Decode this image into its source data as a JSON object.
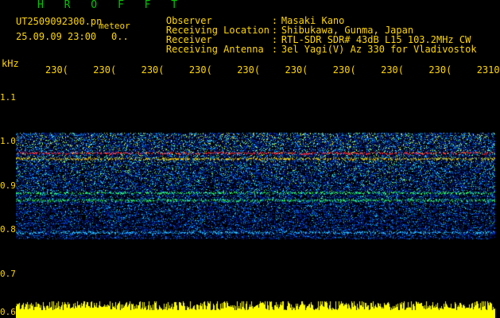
{
  "header": {
    "brand": "H R O F F T",
    "filename": "UT2509092300.pn",
    "meteor_tag": "meteor",
    "datetime": "25.09.09 23:00",
    "status": "0.."
  },
  "info": [
    {
      "label": "Observer",
      "value": "Masaki Kano"
    },
    {
      "label": "Receiving Location",
      "value": "Shibukawa, Gunma, Japan"
    },
    {
      "label": "Receiver",
      "value": "RTL-SDR SDR# 43dB L15 103.2MHz CW"
    },
    {
      "label": "Receiving Antenna",
      "value": "3el Yagi(V) Az 330 for Vladivostok"
    }
  ],
  "chart_data": {
    "type": "heatmap",
    "ylabel": "kHz",
    "x_tick_labels": [
      "230(",
      "230(",
      "230(",
      "230(",
      "230(",
      "230(",
      "230(",
      "230(",
      "230(",
      "2310"
    ],
    "y_tick_labels": [
      "1.1",
      "1.0",
      "0.9",
      "0.8",
      "0.7",
      "0.6"
    ],
    "ylim": [
      0.6,
      1.15
    ],
    "noise_band_khz": [
      0.78,
      1.02
    ],
    "signal_lines_khz": [
      {
        "freq": 0.975,
        "color": "#ff3030"
      },
      {
        "freq": 0.962,
        "color": "#ffd000"
      },
      {
        "freq": 0.885,
        "color": "#30ff60"
      },
      {
        "freq": 0.868,
        "color": "#30ff60"
      },
      {
        "freq": 0.795,
        "color": "#30c0ff"
      }
    ],
    "power_trace_color": "#ffff00"
  }
}
